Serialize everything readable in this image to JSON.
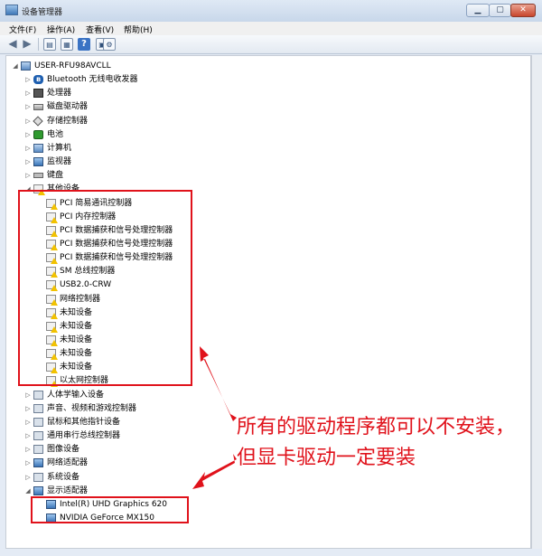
{
  "window": {
    "title": "设备管理器",
    "buttons": {
      "minimize": "▁",
      "maximize": "▢",
      "close": "✕"
    }
  },
  "menu": [
    "文件(F)",
    "操作(A)",
    "查看(V)",
    "帮助(H)"
  ],
  "toolbar": {
    "icons": [
      "back-arrow-icon",
      "forward-arrow-icon",
      "properties-icon",
      "refresh-icon",
      "help-icon",
      "show-icon",
      "scan-icon"
    ]
  },
  "tree": {
    "root": "USER-RFU98AVCLL",
    "categories_top": [
      {
        "label": "Bluetooth 无线电收发器",
        "icon": "bluetooth-icon"
      },
      {
        "label": "处理器",
        "icon": "processor-icon"
      },
      {
        "label": "磁盘驱动器",
        "icon": "disk-icon"
      },
      {
        "label": "存储控制器",
        "icon": "storage-icon"
      },
      {
        "label": "电池",
        "icon": "battery-icon"
      },
      {
        "label": "计算机",
        "icon": "computer-icon"
      },
      {
        "label": "监视器",
        "icon": "monitor-icon"
      },
      {
        "label": "键盘",
        "icon": "keyboard-icon"
      }
    ],
    "other_devices": {
      "label": "其他设备",
      "items": [
        "PCI 简易通讯控制器",
        "PCI 内存控制器",
        "PCI 数据捕获和信号处理控制器",
        "PCI 数据捕获和信号处理控制器",
        "PCI 数据捕获和信号处理控制器",
        "SM 总线控制器",
        "USB2.0-CRW",
        "网络控制器",
        "未知设备",
        "未知设备",
        "未知设备",
        "未知设备",
        "未知设备",
        "以太网控制器"
      ]
    },
    "categories_mid": [
      {
        "label": "人体学输入设备",
        "icon": "hid-icon"
      },
      {
        "label": "声音、视频和游戏控制器",
        "icon": "sound-icon"
      },
      {
        "label": "鼠标和其他指针设备",
        "icon": "mouse-icon"
      },
      {
        "label": "通用串行总线控制器",
        "icon": "usb-icon"
      },
      {
        "label": "图像设备",
        "icon": "camera-icon"
      },
      {
        "label": "网络适配器",
        "icon": "network-icon"
      },
      {
        "label": "系统设备",
        "icon": "system-icon"
      }
    ],
    "display_adapters": {
      "label": "显示适配器",
      "items": [
        "Intel(R) UHD Graphics 620",
        "NVIDIA GeForce MX150"
      ]
    }
  },
  "annotation": {
    "text": "所有的驱动程序都可以不安装，但显卡驱动一定要装",
    "color": "#e0121b"
  }
}
